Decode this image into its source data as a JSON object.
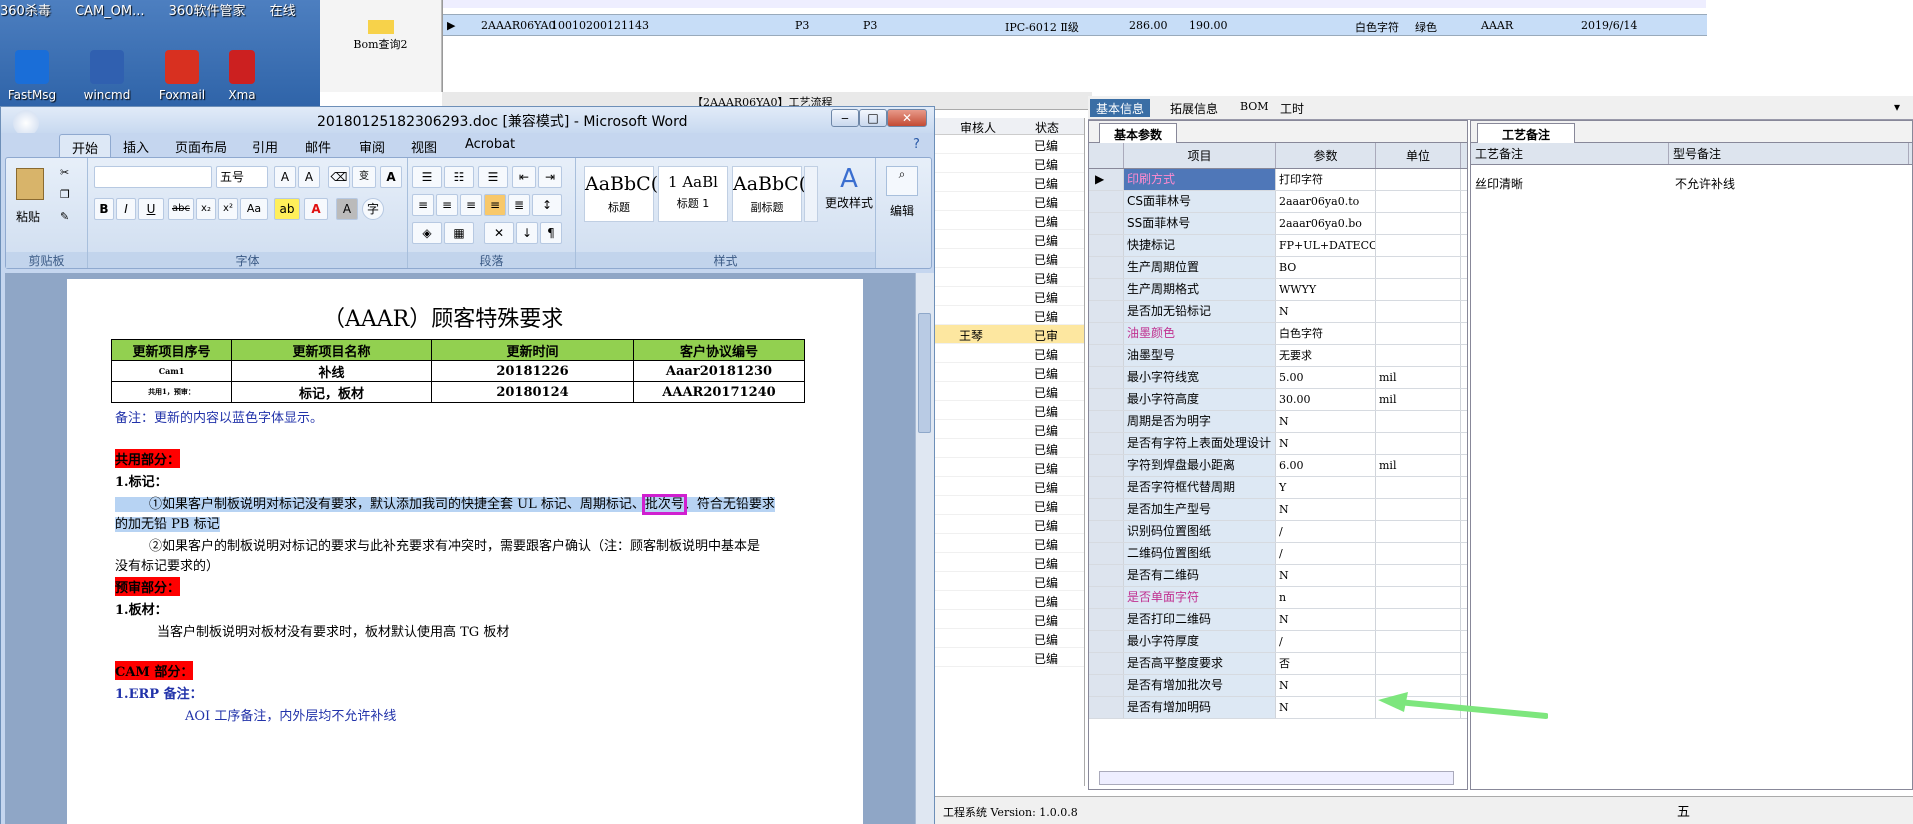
{
  "desktop": {
    "top_labels": [
      "360杀毒",
      "CAM_OM...",
      "360软件管家",
      "在线"
    ],
    "icons": [
      {
        "label": "FastMsg",
        "color": "#1a6ed8"
      },
      {
        "label": "wincmd",
        "color": "#3060b0"
      },
      {
        "label": "Foxmail",
        "color": "#d83020"
      },
      {
        "label": "Xma",
        "color": "#cc2020"
      }
    ]
  },
  "bom_tab": {
    "label": "Bom查询2"
  },
  "top_row": {
    "cells": [
      "2AAAR06YA0",
      "10010200121143",
      "P3",
      "P3",
      "IPC-6012 Ⅱ级",
      "286.00",
      "190.00",
      "白色字符",
      "绿色",
      "AAAR",
      "2019/6/14"
    ]
  },
  "mid_strip": {
    "label": "【2AAAR06YA0】工艺流程"
  },
  "list": {
    "headers": [
      "审核人",
      "状态"
    ],
    "status": "已编",
    "approver": "王琴",
    "status_alt": "已审",
    "rows": 28
  },
  "tabs": [
    "基本信息",
    "拓展信息",
    "BOM",
    "工时"
  ],
  "basic_panel": {
    "title": "基本参数",
    "headers": [
      "项目",
      "参数",
      "单位"
    ],
    "rows": [
      {
        "item": "印刷方式",
        "value": "打印字符",
        "unit": "",
        "pink": true
      },
      {
        "item": "CS面菲林号",
        "value": "2aaar06ya0.to",
        "unit": ""
      },
      {
        "item": "SS面菲林号",
        "value": "2aaar06ya0.bo",
        "unit": ""
      },
      {
        "item": "快捷标记",
        "value": "FP+UL+DATECODE",
        "unit": ""
      },
      {
        "item": "生产周期位置",
        "value": "BO",
        "unit": ""
      },
      {
        "item": "生产周期格式",
        "value": "WWYY",
        "unit": ""
      },
      {
        "item": "是否加无铅标记",
        "value": "N",
        "unit": ""
      },
      {
        "item": "油墨颜色",
        "value": "白色字符",
        "unit": "",
        "pink": true
      },
      {
        "item": "油墨型号",
        "value": "无要求",
        "unit": ""
      },
      {
        "item": "最小字符线宽",
        "value": "5.00",
        "unit": "mil"
      },
      {
        "item": "最小字符高度",
        "value": "30.00",
        "unit": "mil"
      },
      {
        "item": "周期是否为明字",
        "value": "N",
        "unit": ""
      },
      {
        "item": "是否有字符上表面处理设计",
        "value": "N",
        "unit": ""
      },
      {
        "item": "字符到焊盘最小距离",
        "value": "6.00",
        "unit": "mil"
      },
      {
        "item": "是否字符框代替周期",
        "value": "Y",
        "unit": ""
      },
      {
        "item": "是否加生产型号",
        "value": "N",
        "unit": ""
      },
      {
        "item": "识别码位置图纸",
        "value": "/",
        "unit": ""
      },
      {
        "item": "二维码位置图纸",
        "value": "/",
        "unit": ""
      },
      {
        "item": "是否有二维码",
        "value": "N",
        "unit": ""
      },
      {
        "item": "是否单面字符",
        "value": "n",
        "unit": "",
        "pink": true
      },
      {
        "item": "是否打印二维码",
        "value": "N",
        "unit": ""
      },
      {
        "item": "最小字符厚度",
        "value": "/",
        "unit": ""
      },
      {
        "item": "是否高平整度要求",
        "value": "否",
        "unit": ""
      },
      {
        "item": "是否有增加批次号",
        "value": "N",
        "unit": ""
      },
      {
        "item": "是否有增加明码",
        "value": "N",
        "unit": ""
      }
    ]
  },
  "process_panel": {
    "title": "工艺备注",
    "headers": [
      "工艺备注",
      "型号备注"
    ],
    "process_note": "丝印清晰",
    "model_note": "不允许补线"
  },
  "status_bar": {
    "text": "工程系统 Version: 1.0.0.8",
    "ime": "五"
  },
  "word": {
    "title": "20180125182306293.doc [兼容模式] - Microsoft Word",
    "tabs": [
      "开始",
      "插入",
      "页面布局",
      "引用",
      "邮件",
      "审阅",
      "视图",
      "Acrobat"
    ],
    "groups": [
      "剪贴板",
      "字体",
      "段落",
      "样式"
    ],
    "paste": "粘贴",
    "font_size": "五号",
    "change_styles": "更改样式",
    "edit": "编辑",
    "styles": [
      {
        "sample": "AaBbC(",
        "name": "标题"
      },
      {
        "sample": "1  AaBl",
        "name": "标题 1"
      },
      {
        "sample": "AaBbC(",
        "name": "副标题"
      }
    ],
    "doc": {
      "heading": "（AAAR）顾客特殊要求",
      "table_headers": [
        "更新项目序号",
        "更新项目名称",
        "更新时间",
        "客户协议编号"
      ],
      "table_rows": [
        [
          "Cam1",
          "补线",
          "20181226",
          "Aaar20181230"
        ],
        [
          "共用1，预审：",
          "标记，板材",
          "20180124",
          "AAAR20171240"
        ]
      ],
      "note": "备注：更新的内容以蓝色字体显示。",
      "sec1": "共用部分：",
      "sec1_1": "1.标记：",
      "p1a": "①如果客户制板说明对标记没有要求，默认添加我司的快捷全套 UL 标记、周期标记、",
      "p1_box": "批次号",
      "p1b": "、符合无铅要求",
      "p1c": "的加无铅 PB 标记",
      "p2a": "②如果客户的制板说明对标记的要求与此补充要求有冲突时，需要跟客户确认（注：顾客制板说明中基本是",
      "p2b": "没有标记要求的）",
      "sec2": "预审部分：",
      "sec2_1": "1.板材：",
      "p3": "当客户制板说明对板材没有要求时，板材默认使用高 TG 板材",
      "sec3": "CAM 部分：",
      "sec3_1": "1.ERP 备注：",
      "p4": "AOI 工序备注，内外层均不允许补线"
    }
  }
}
